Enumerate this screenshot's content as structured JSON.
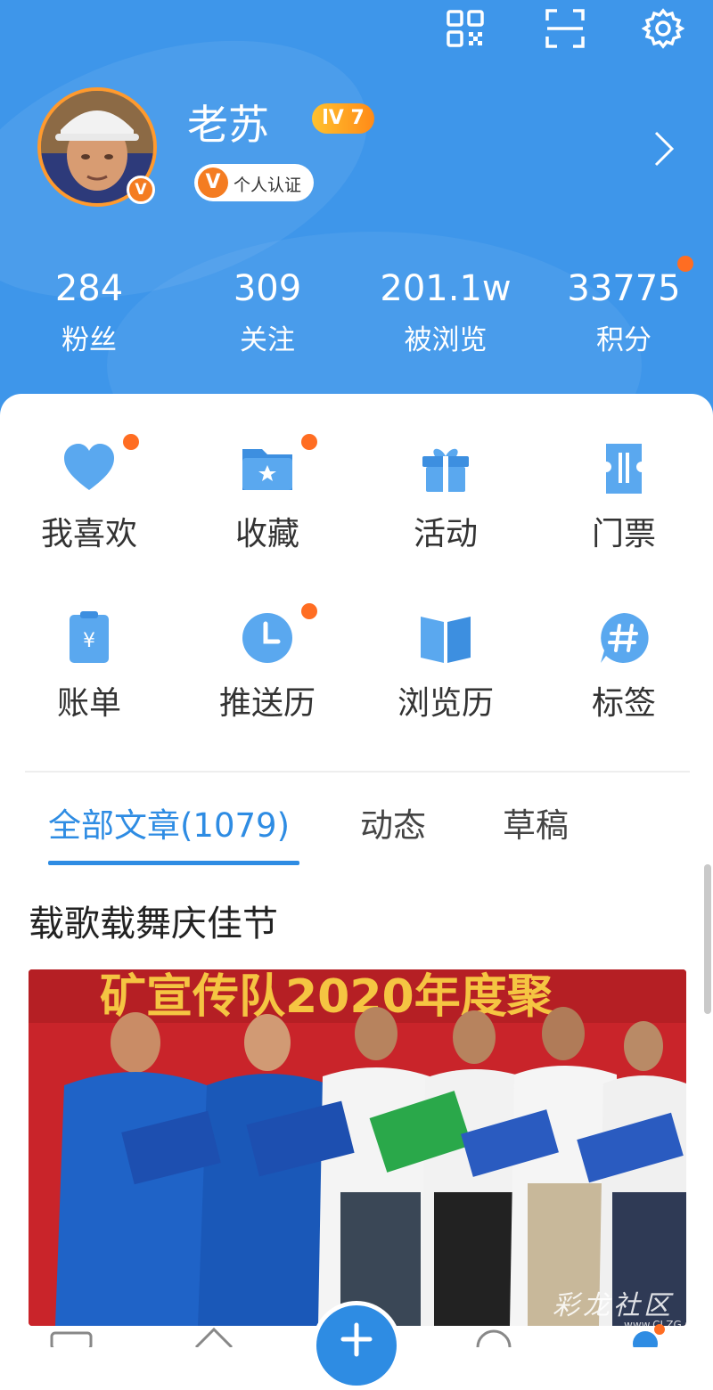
{
  "header": {
    "icons": [
      "qr-code-icon",
      "scan-icon",
      "settings-icon"
    ],
    "username": "老苏",
    "level": "lV 7",
    "verify_badge": "V",
    "verify_label": "个人认证",
    "colors": {
      "header_bg": "#3e96ea",
      "accent_orange": "#f47c21",
      "badge_dot": "#ff6d22"
    }
  },
  "stats": [
    {
      "value": "284",
      "label": "粉丝"
    },
    {
      "value": "309",
      "label": "关注"
    },
    {
      "value": "201.1w",
      "label": "被浏览"
    },
    {
      "value": "33775",
      "label": "积分"
    }
  ],
  "menu": [
    {
      "label": "我喜欢",
      "icon": "heart-icon",
      "has_dot": true
    },
    {
      "label": "收藏",
      "icon": "folder-star-icon",
      "has_dot": true
    },
    {
      "label": "活动",
      "icon": "gift-icon",
      "has_dot": false
    },
    {
      "label": "门票",
      "icon": "ticket-icon",
      "has_dot": false
    },
    {
      "label": "账单",
      "icon": "bill-icon",
      "has_dot": false
    },
    {
      "label": "推送历",
      "icon": "clock-icon",
      "has_dot": true
    },
    {
      "label": "浏览历",
      "icon": "book-icon",
      "has_dot": false
    },
    {
      "label": "标签",
      "icon": "hashtag-icon",
      "has_dot": false
    }
  ],
  "tabs": [
    {
      "label": "全部文章(1079)",
      "active": true
    },
    {
      "label": "动态",
      "active": false
    },
    {
      "label": "草稿",
      "active": false
    }
  ],
  "article": {
    "title": "载歌载舞庆佳节",
    "banner_text": "矿宣传队2020年度聚"
  },
  "watermark": {
    "text": "彩龙社区",
    "sub": "www.CLZG.CN"
  }
}
